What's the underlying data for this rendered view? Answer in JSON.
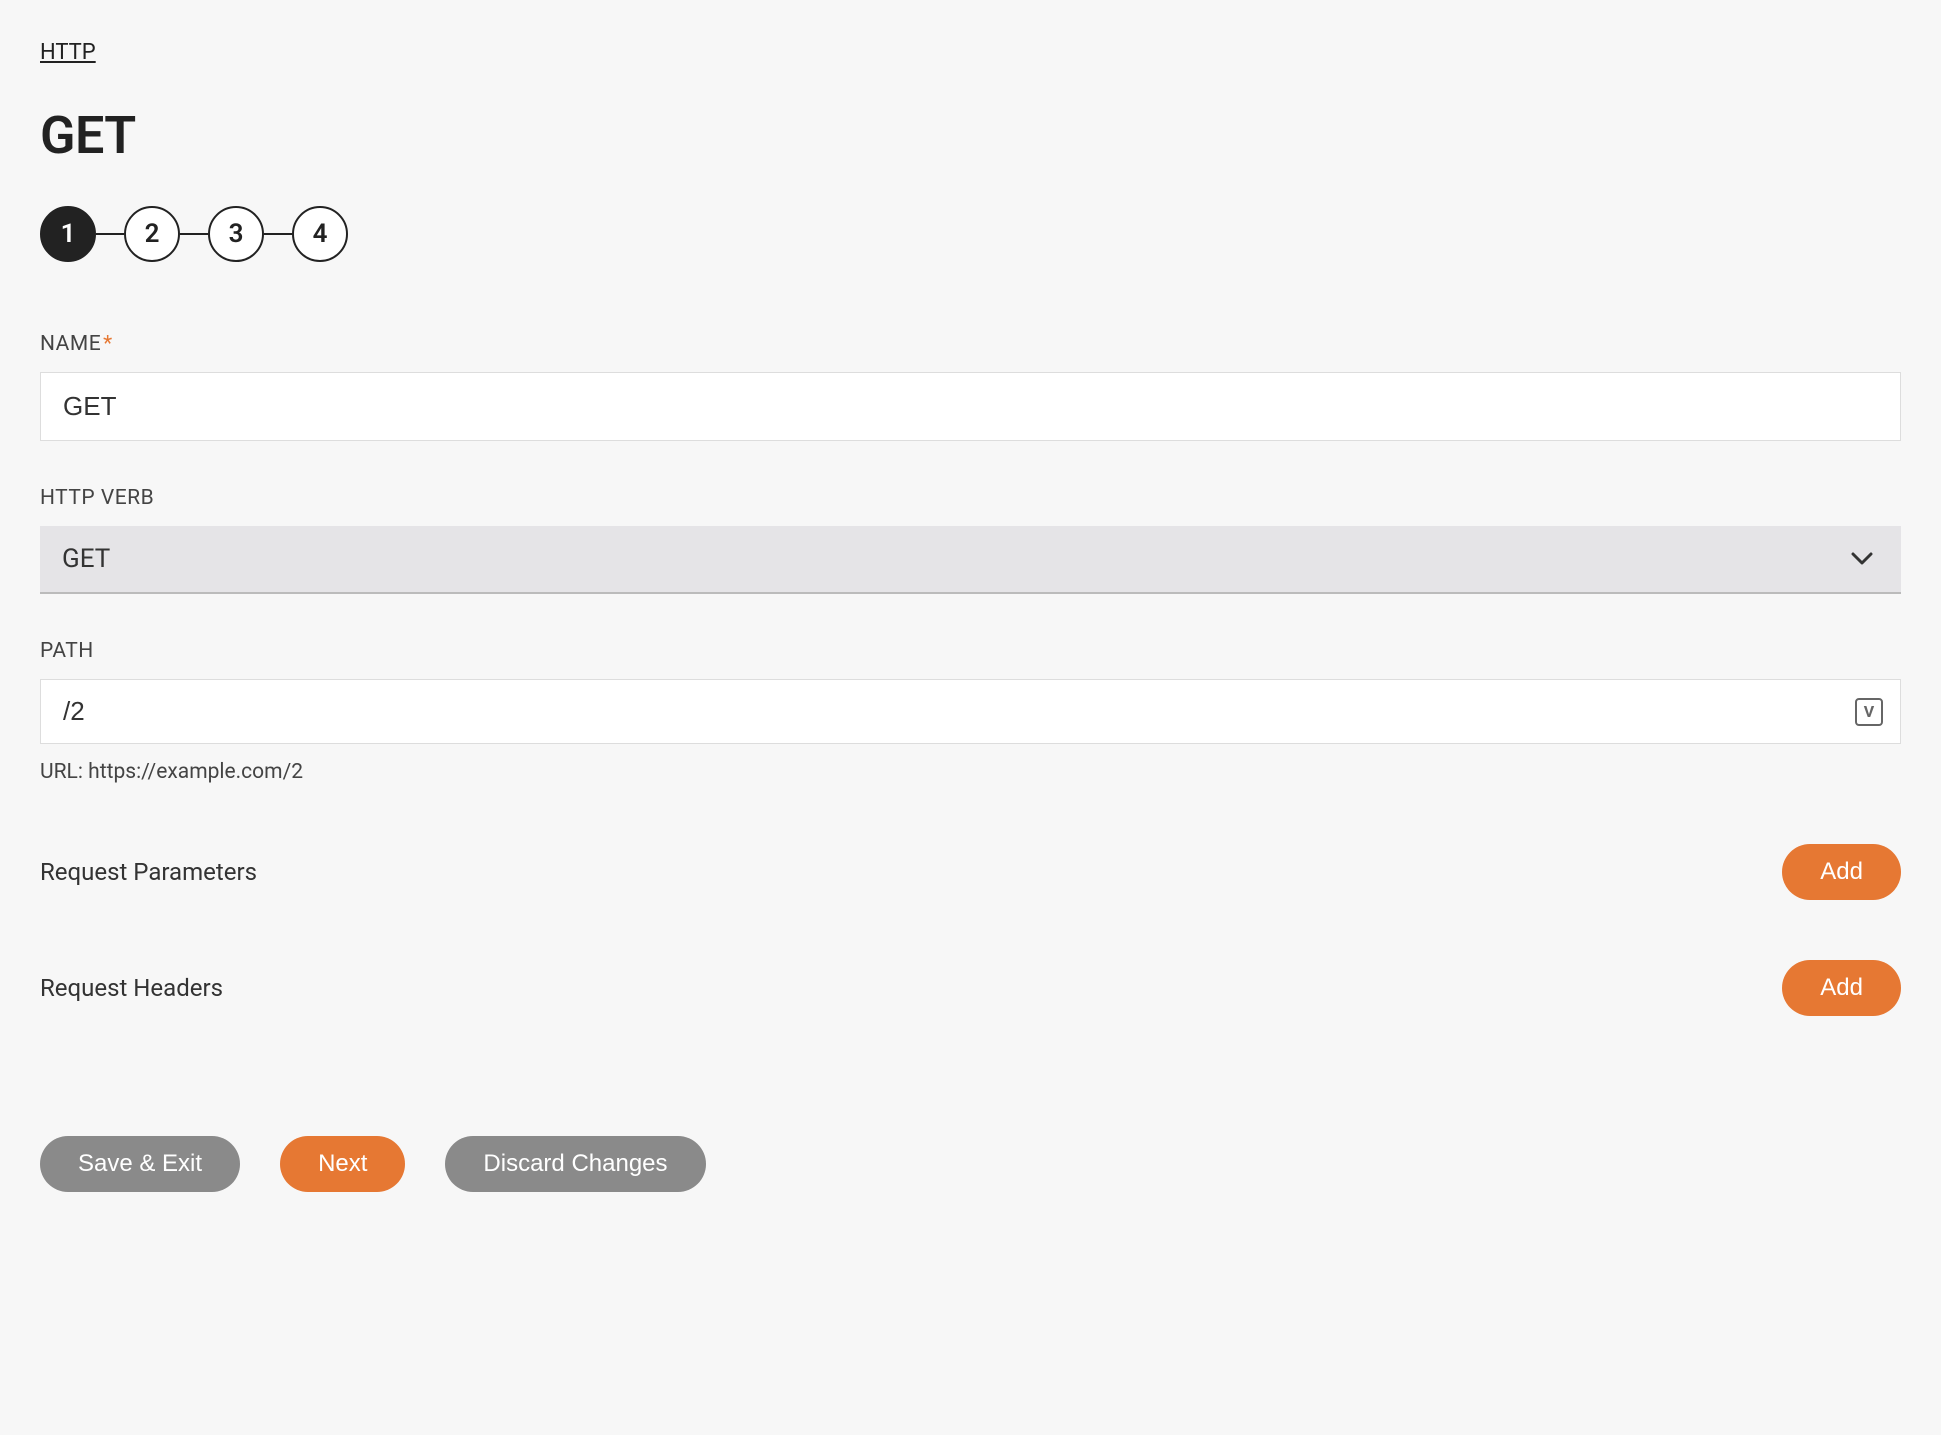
{
  "breadcrumb": "HTTP",
  "page_title": "GET",
  "stepper": {
    "steps": [
      "1",
      "2",
      "3",
      "4"
    ],
    "active_index": 0
  },
  "fields": {
    "name": {
      "label": "NAME",
      "required": true,
      "value": "GET"
    },
    "http_verb": {
      "label": "HTTP VERB",
      "value": "GET"
    },
    "path": {
      "label": "PATH",
      "value": "/2",
      "helper": "URL: https://example.com/2"
    }
  },
  "sections": {
    "request_parameters": {
      "label": "Request Parameters",
      "add_label": "Add"
    },
    "request_headers": {
      "label": "Request Headers",
      "add_label": "Add"
    }
  },
  "footer": {
    "save_exit": "Save & Exit",
    "next": "Next",
    "discard": "Discard Changes"
  }
}
